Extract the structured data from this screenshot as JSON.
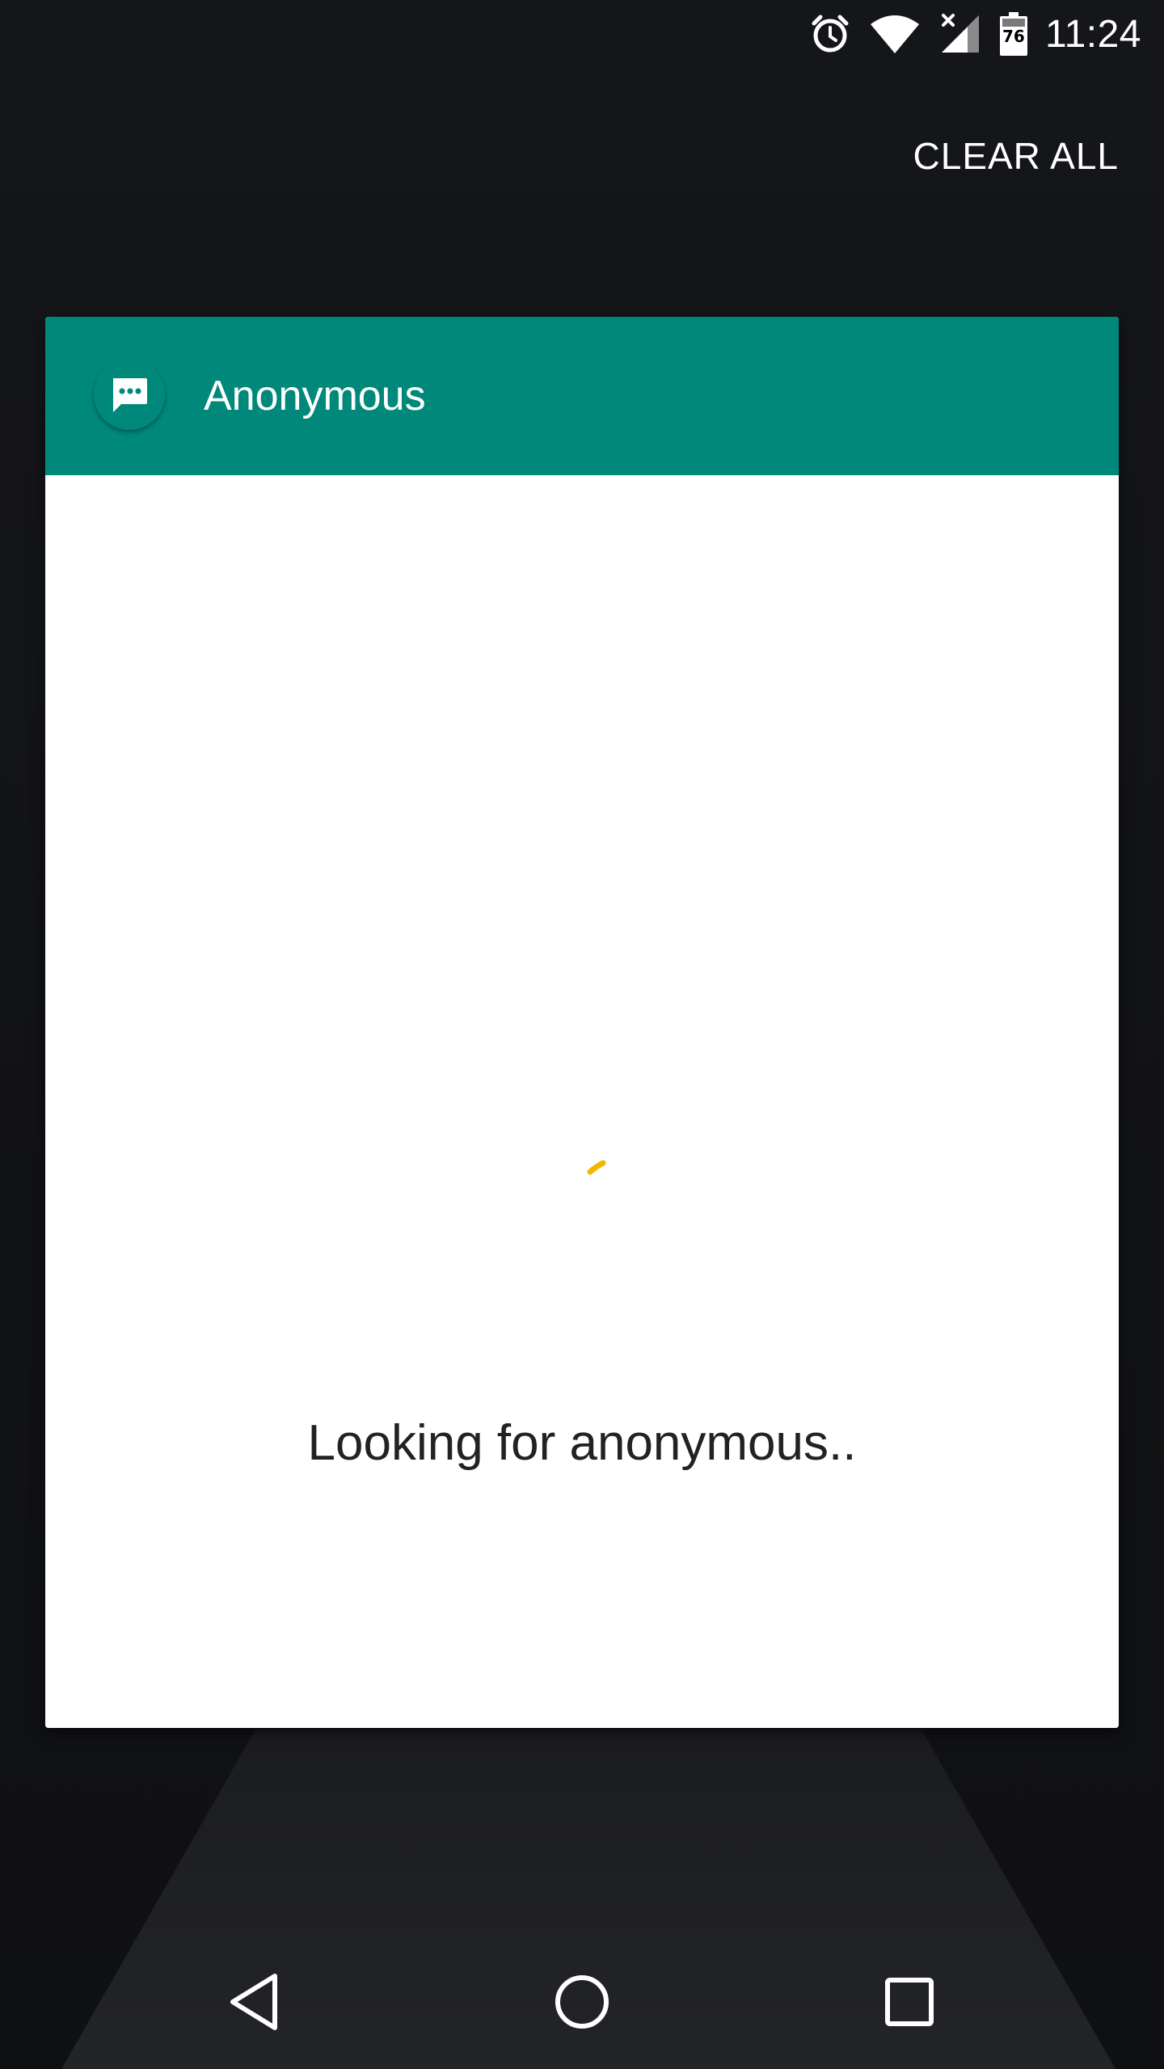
{
  "status_bar": {
    "time": "11:24",
    "battery_level": "76",
    "icons": [
      "alarm-icon",
      "wifi-icon",
      "cell-signal-no-service-icon",
      "battery-icon"
    ]
  },
  "recents": {
    "clear_all_label": "CLEAR ALL"
  },
  "task_card": {
    "app_title": "Anonymous",
    "app_icon": "chat-bubble-icon",
    "header_color": "#00897b",
    "loading_text": "Looking for anonymous..",
    "spinner_color": "#f4b400"
  },
  "nav_bar": {
    "icons": [
      "back-icon",
      "home-icon",
      "recents-icon"
    ]
  }
}
